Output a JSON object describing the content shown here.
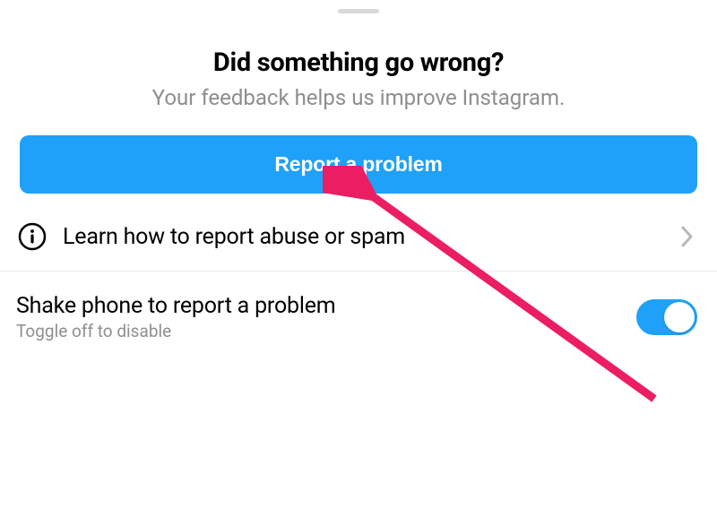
{
  "header": {
    "title": "Did something go wrong?",
    "subtitle": "Your feedback helps us improve Instagram."
  },
  "actions": {
    "report_button": "Report a problem"
  },
  "learn_row": {
    "label": "Learn how to report abuse or spam"
  },
  "shake_section": {
    "title": "Shake phone to report a problem",
    "subtitle": "Toggle off to disable",
    "enabled": true
  },
  "colors": {
    "accent": "#1fa1f9",
    "secondary_text": "#8e8e8e",
    "annotation": "#eb1d63"
  }
}
